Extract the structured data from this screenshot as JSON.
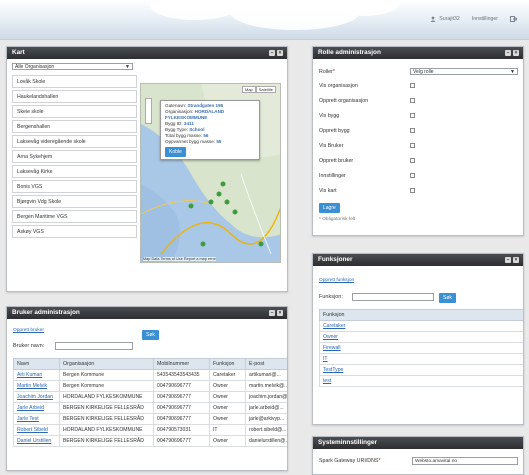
{
  "topbar": {
    "user": "Surajit32",
    "settings": "Innstillinger"
  },
  "kart": {
    "title": "Kart",
    "org_select": "Alle Organisasjon",
    "locations": [
      "Lovåk Skole",
      "Haukelandshallen",
      "Skeie skole",
      "Bergenshallen",
      "Laksevåg videregående skole",
      "Arna Sykehjem",
      "Laksevåg Kirke",
      "Bonis VGS",
      "Bjørgvin Vdg Skole",
      "Bergen Maritime VGS",
      "Askøy VGS"
    ],
    "map": {
      "maptype_map": "Map",
      "maptype_sat": "Satellite",
      "popup": {
        "l1_label": "Gatenavn:",
        "l1_val": "Strandgaten 195",
        "l2_label": "Organisasjon:",
        "l2_val": "HORDALAND FYLKESKOMMUNE",
        "l3_label": "Bygg ID:",
        "l3_val": "3411",
        "l4_label": "Bygg Type:",
        "l4_val": "School",
        "l5_label": "Total bygg masse:",
        "l5_val": "56",
        "l6_label": "Oppvarmet bygg masse:",
        "l6_val": "55",
        "btn": "Koble"
      },
      "footer": "Map Data   Terms of Use   Report a map error"
    }
  },
  "rolle": {
    "title": "Rolle administrasjon",
    "role_label": "Roller",
    "role_select": "Velg rolle",
    "items": [
      "Vis organisasjon",
      "Opprett organisasjon",
      "Vis bygg",
      "Opprett bygg",
      "Vis Bruker",
      "Opprett bruker",
      "Innstillinger",
      "Vis kart"
    ],
    "save": "Lagre",
    "required_note": "* Obligatorisk felt"
  },
  "funksjoner": {
    "title": "Funksjoner",
    "create_link": "Opprett funksjon",
    "label": "Funksjon:",
    "search": "Søk",
    "col": "Funksjon",
    "rows": [
      "Caretaker",
      "Owner",
      "Firewall",
      "IT",
      "TestType",
      "test"
    ]
  },
  "bruker": {
    "title": "Bruker administrasjon",
    "create_link": "Opprett bruker",
    "label": "Bruker navn:",
    "search": "Søk",
    "cols": [
      "Navn",
      "Organisasjon",
      "Mobilnummer",
      "Funksjon",
      "E-post"
    ],
    "rows": [
      [
        "Arti Kumari",
        "Bergen Kommune",
        "543543543543435",
        "Caretaker",
        "artikumari@..."
      ],
      [
        "Martin Melvik",
        "Bergen Kommune",
        "004790696777",
        "Owner",
        "martin.melvik@..."
      ],
      [
        "Joachim Jordan",
        "HORDALAND FYLKESKOMMUNE",
        "004790696777",
        "Owner",
        "joachim.jordan@..."
      ],
      [
        "Jarle Arbeid",
        "BERGEN KIRKELIGE FELLESRÅD",
        "004790696777",
        "Owner",
        "jarle.arbeid@..."
      ],
      [
        "Jarle Test",
        "BERGEN KIRKELIGE FELLESRÅD",
        "004790696777",
        "Owner",
        "jarle@arkivyp..."
      ],
      [
        "Robert Sibeld",
        "HORDALAND FYLKESKOMMUNE",
        "004790573031",
        "IT",
        "robert.sibeld@..."
      ],
      [
        "Daniel Urstillen",
        "BERGEN KIRKELIGE FELLESRÅD",
        "004790696777",
        "Owner",
        "danielurstillen@..."
      ]
    ]
  },
  "system": {
    "title": "Systeminnstillinger",
    "gateway_label": "Spark Gateway URI/DNS",
    "gateway_value": "Websto.amavital.no"
  }
}
